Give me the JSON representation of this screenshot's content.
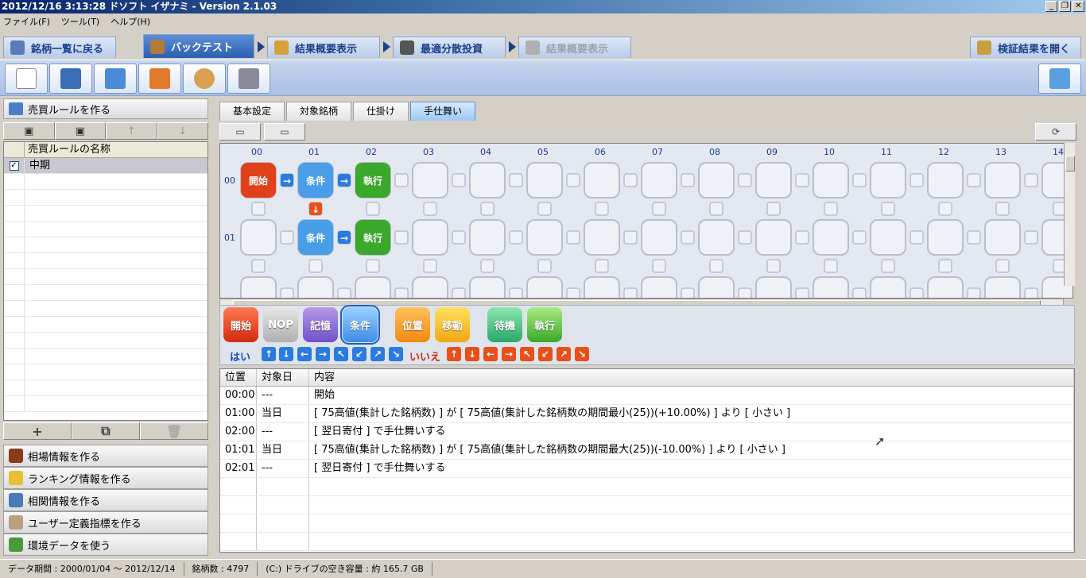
{
  "window": {
    "title": "2012/12/16 3:13:28 ドソフト イザナミ - Version 2.1.03"
  },
  "menu": [
    "ファイル(F)",
    "ツール(T)",
    "ヘルプ(H)"
  ],
  "nav": {
    "back": "銘柄一覧に戻る",
    "backtest": "バックテスト",
    "summary": "結果概要表示",
    "optimal": "最適分散投資",
    "summary2": "結果概要表示",
    "open_results": "検証結果を開く"
  },
  "left": {
    "create_rule": "売買ルールを作る",
    "grid_header": "売買ルールの名称",
    "rules": [
      {
        "name": "中期",
        "checked": "✓"
      }
    ],
    "menus": [
      "相場情報を作る",
      "ランキング情報を作る",
      "相関情報を作る",
      "ユーザー定義指標を作る",
      "環境データを使う"
    ]
  },
  "tabs": [
    "基本設定",
    "対象銘柄",
    "仕掛け",
    "手仕舞い"
  ],
  "flow": {
    "columns": [
      "00",
      "01",
      "02",
      "03",
      "04",
      "05",
      "06",
      "07",
      "08",
      "09",
      "10",
      "11",
      "12",
      "13",
      "14"
    ],
    "rows": [
      "00",
      "01"
    ],
    "nodes": {
      "start": "開始",
      "cond": "条件",
      "exec": "執行"
    }
  },
  "palette": {
    "buttons": [
      "開始",
      "NOP",
      "記憶",
      "条件",
      "位置",
      "移動",
      "待機",
      "執行"
    ],
    "yes": "はい",
    "no": "いいえ"
  },
  "table": {
    "headers": [
      "位置",
      "対象日",
      "内容"
    ],
    "rows": [
      [
        "00:00",
        "---",
        "開始"
      ],
      [
        "01:00",
        "当日",
        "[ 75高値(集計した銘柄数) ] が [ 75高値(集計した銘柄数の期間最小(25))(+10.00%) ] より [ 小さい ]"
      ],
      [
        "02:00",
        "---",
        "[ 翌日寄付 ] で手仕舞いする"
      ],
      [
        "01:01",
        "当日",
        "[ 75高値(集計した銘柄数) ] が [ 75高値(集計した銘柄数の期間最大(25))(-10.00%) ] より [ 小さい ]"
      ],
      [
        "02:01",
        "---",
        "[ 翌日寄付 ] で手仕舞いする"
      ]
    ]
  },
  "status": {
    "period": "データ期間 : 2000/01/04 〜 2012/12/14",
    "count": "銘柄数 : 4797",
    "disk": "(C:) ドライブの空き容量 : 約 165.7 GB"
  }
}
